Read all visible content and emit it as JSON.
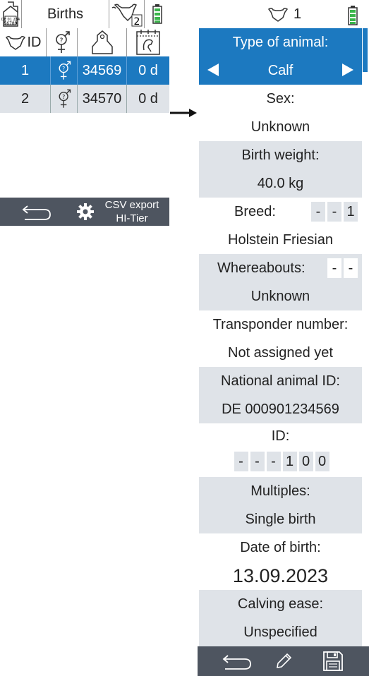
{
  "left": {
    "title": "Births",
    "group_count": "2",
    "col_id": "ID",
    "rows": [
      {
        "num": "1",
        "eartag": "34569",
        "age": "0 d"
      },
      {
        "num": "2",
        "eartag": "34570",
        "age": "0 d"
      }
    ],
    "footer": {
      "csv_line1": "CSV export",
      "csv_line2": "HI-Tier"
    }
  },
  "right": {
    "header_count": "1",
    "type_label": "Type of animal:",
    "type_value": "Calf",
    "sex_label": "Sex:",
    "sex_value": "Unknown",
    "weight_label": "Birth weight:",
    "weight_value": "40.0 kg",
    "breed_label": "Breed:",
    "breed_digits": [
      "-",
      "-",
      "1"
    ],
    "breed_value": "Holstein Friesian",
    "whereabouts_label": "Whereabouts:",
    "whereabouts_digits": [
      "-",
      "-"
    ],
    "whereabouts_value": "Unknown",
    "transponder_label": "Transponder number:",
    "transponder_value": "Not assigned yet",
    "national_label": "National animal ID:",
    "national_value": "DE 000901234569",
    "id_label": "ID:",
    "id_digits": [
      "-",
      "-",
      "-",
      "1",
      "0",
      "0"
    ],
    "multiples_label": "Multiples:",
    "multiples_value": "Single birth",
    "dob_label": "Date of birth:",
    "dob_value": "13.09.2023",
    "ease_label": "Calving ease:",
    "ease_value": "Unspecified"
  },
  "colors": {
    "selected": "#1c79c0",
    "grey": "#dfe3e8",
    "footer": "#4e5560",
    "battery": "#3ab54a"
  }
}
